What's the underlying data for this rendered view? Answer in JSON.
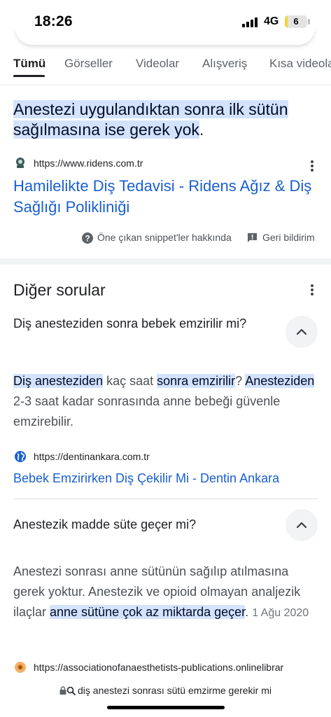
{
  "status_bar": {
    "time": "18:26",
    "network": "4G",
    "battery_level": "6",
    "battery_fraction": 0.06
  },
  "tabs": [
    {
      "label": "Tümü",
      "active": true
    },
    {
      "label": "Görseller"
    },
    {
      "label": "Videolar"
    },
    {
      "label": "Alışveriş"
    },
    {
      "label": "Kısa videolar"
    }
  ],
  "featured_snippet": {
    "text_highlighted": "Anestezi uygulandıktan sonra ilk sütün sağılmasına ise gerek yok",
    "text_tail": ".",
    "source_url": "https://www.ridens.com.tr",
    "title": "Hamilelikte Diş Tedavisi - Ridens Ağız & Diş Sağlığı Polikliniği",
    "about_label": "Öne çıkan snippet'ler hakkında",
    "feedback_label": "Geri bildirim"
  },
  "other_questions": {
    "title": "Diğer sorular",
    "items": [
      {
        "question": "Diş anesteziden sonra bebek emzirilir mi?",
        "answer": {
          "hl1": "Diş anesteziden",
          "t1": " kaç saat ",
          "hl2": "sonra emzirilir",
          "t2": "? ",
          "hl3": "Anesteziden",
          "t3": " 2-3 saat kadar sonrasında anne bebeği güvenle emzirebilir."
        },
        "source_url": "https://dentinankara.com.tr",
        "source_title": "Bebek Emzirirken Diş Çekilir Mi - Dentin Ankara"
      },
      {
        "question": "Anestezik madde süte geçer mi?",
        "answer": {
          "t1": "Anestezi sonrası anne sütünün sağılıp atılmasına gerek yoktur. Anestezik ve opioid olmayan analjezik ilaçlar ",
          "hl1": "anne sütüne çok az miktarda geçer",
          "t2": ". ",
          "date": "1 Ağu 2020"
        },
        "source_url": "https://associationofanaesthetists-publications.onlinelibrar"
      }
    ]
  },
  "bottom_bar": {
    "url": "diş anestezi sonrası sütü emzirme gerekir mi"
  },
  "icons": {
    "status": [
      "signal-icon",
      "battery-icon"
    ],
    "snippet": [
      "ridens-favicon",
      "more-options-icon",
      "help-icon",
      "feedback-icon"
    ],
    "questions": [
      "chevron-up-icon",
      "globe-icon",
      "sunflower-favicon"
    ],
    "bottom": [
      "lock-icon",
      "search-icon"
    ]
  },
  "colors": {
    "highlight": "#d3e3fd",
    "link": "#1a5fd0",
    "battery": "#f4d23d"
  }
}
